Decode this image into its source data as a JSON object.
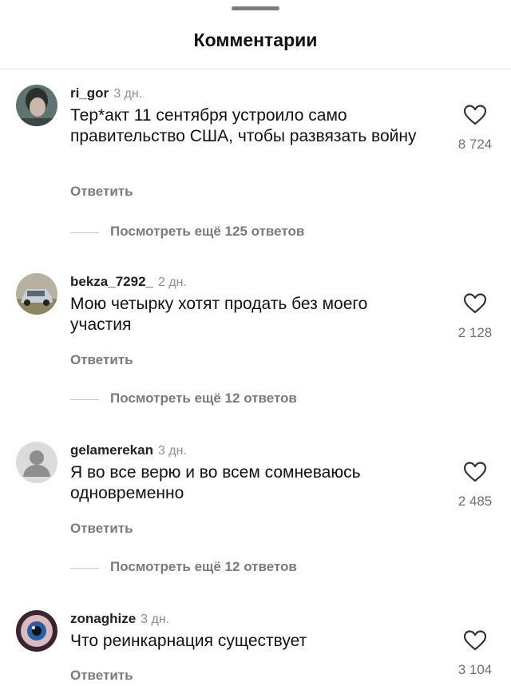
{
  "header": {
    "title": "Комментарии"
  },
  "comments": [
    {
      "username": "ri_gor",
      "time": "3 дн.",
      "text": "Тер*акт 11 сентября устроило само правительство США, чтобы развязать войну",
      "reply_label": "Ответить",
      "likes": "8 724",
      "more_replies": "Посмотреть ещё 125 ответов",
      "avatar": "photo-avatar-person"
    },
    {
      "username": "bekza_7292_",
      "time": "2 дн.",
      "text": "Мою четырку хотят продать без моего участия",
      "reply_label": "Ответить",
      "likes": "2 128",
      "more_replies": "Посмотреть ещё 12 ответов",
      "avatar": "photo-avatar-car"
    },
    {
      "username": "gelamerekan",
      "time": "3 дн.",
      "text": "Я во все верю и во всем сомневаюсь одновременно",
      "reply_label": "Ответить",
      "likes": "2 485",
      "more_replies": "Посмотреть ещё 12 ответов",
      "avatar": "default-avatar"
    },
    {
      "username": "zonaghize",
      "time": "3 дн.",
      "text": "Что  реинкарнация существует",
      "reply_label": "Ответить",
      "likes": "3 104",
      "avatar": "photo-avatar-eye"
    }
  ]
}
